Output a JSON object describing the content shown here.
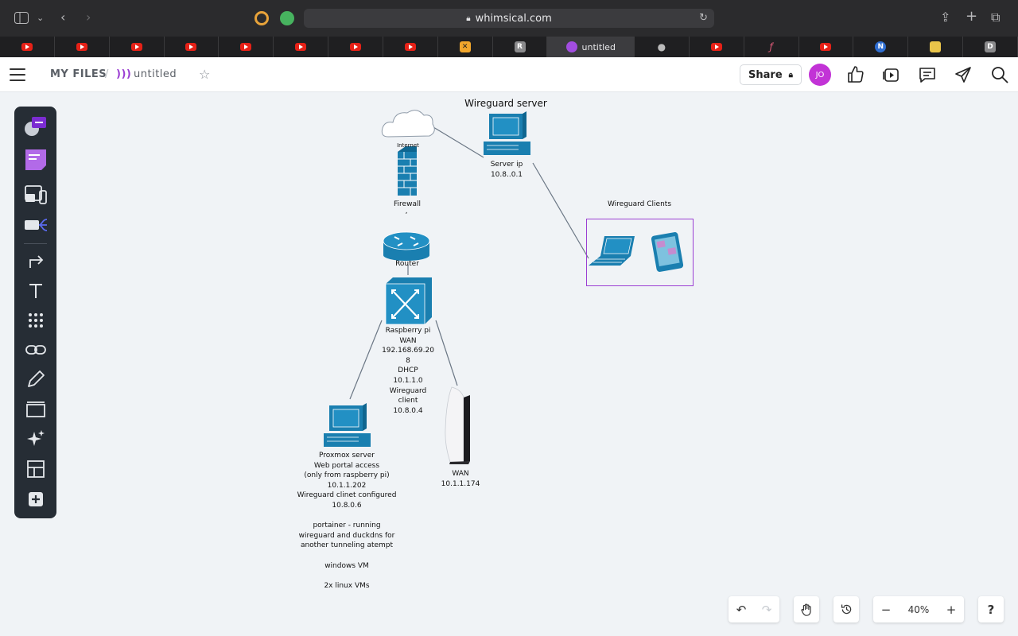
{
  "browser": {
    "url": "whimsical.com",
    "active_tab_title": "untitled",
    "tab_letters": {
      "r": "R",
      "d": "D"
    }
  },
  "header": {
    "section": "MY FILES",
    "separator": "/",
    "doc_title": "untitled",
    "share_label": "Share",
    "avatar_initials": "JO"
  },
  "diagram": {
    "title": "Wireguard server",
    "internet_label": "Internet",
    "server_label": "Server ip\n10.8..0.1",
    "firewall_label": "Firewall",
    "firewall_mark": ",",
    "router_label": "Router",
    "clients_label": "Wireguard Clients",
    "raspberry_label": "Raspberry pi\nWAN\n192.168.69.20\n8\nDHCP\n10.1.1.0\nWireguard\nclient\n10.8.0.4",
    "proxmox_label": "Proxmox server\nWeb portal access\n(only from raspberry pi)\n10.1.1.202\nWireguard clinet  configured\n10.8.0.6\n\nportainer - running\nwireguard and duckdns for\nanother tunneling atempt\n\nwindows VM\n\n2x linux VMs",
    "console_label": "WAN\n10.1.1.174"
  },
  "zoom": {
    "level": "40%",
    "minus": "−",
    "plus": "+"
  },
  "help_label": "?",
  "colors": {
    "accent": "#c233d6",
    "device_blue": "#1a7fb0",
    "toolbar_bg": "#262d35",
    "clients_frame": "#9b3fd3"
  }
}
